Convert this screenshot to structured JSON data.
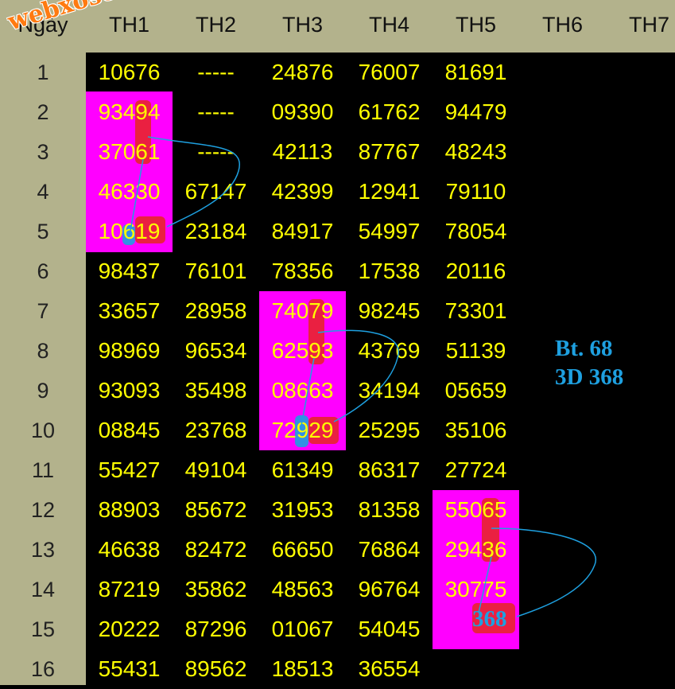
{
  "logo_text": "webxoso.net",
  "header": {
    "day": "Ngày",
    "cols": [
      "TH1",
      "TH2",
      "TH3",
      "TH4",
      "TH5",
      "TH6",
      "TH7"
    ]
  },
  "days": [
    "1",
    "2",
    "3",
    "4",
    "5",
    "6",
    "7",
    "8",
    "9",
    "10",
    "11",
    "12",
    "13",
    "14",
    "15",
    "16"
  ],
  "rows": [
    [
      "10676",
      "-----",
      "24876",
      "76007",
      "81691",
      "",
      ""
    ],
    [
      "93494",
      "-----",
      "09390",
      "61762",
      "94479",
      "",
      ""
    ],
    [
      "37061",
      "-----",
      "42113",
      "87767",
      "48243",
      "",
      ""
    ],
    [
      "46330",
      "67147",
      "42399",
      "12941",
      "79110",
      "",
      ""
    ],
    [
      "10619",
      "23184",
      "84917",
      "54997",
      "78054",
      "",
      ""
    ],
    [
      "98437",
      "76101",
      "78356",
      "17538",
      "20116",
      "",
      ""
    ],
    [
      "33657",
      "28958",
      "74079",
      "98245",
      "73301",
      "",
      ""
    ],
    [
      "98969",
      "96534",
      "62593",
      "43769",
      "51139",
      "",
      ""
    ],
    [
      "93093",
      "35498",
      "08663",
      "34194",
      "05659",
      "",
      ""
    ],
    [
      "08845",
      "23768",
      "72929",
      "25295",
      "35106",
      "",
      ""
    ],
    [
      "55427",
      "49104",
      "61349",
      "86317",
      "27724",
      "",
      ""
    ],
    [
      "88903",
      "85672",
      "31953",
      "81358",
      "55065",
      "",
      ""
    ],
    [
      "46638",
      "82472",
      "66650",
      "76864",
      "29436",
      "",
      ""
    ],
    [
      "87219",
      "35862",
      "48563",
      "96764",
      "30775",
      "",
      ""
    ],
    [
      "20222",
      "87296",
      "01067",
      "54045",
      "",
      "",
      ""
    ],
    [
      "55431",
      "89562",
      "18513",
      "36554",
      "",
      "",
      ""
    ]
  ],
  "annotations": {
    "bt": "Bt. 68",
    "d3": "3D 368",
    "n368": "368"
  },
  "colors": {
    "header_bg": "#b3b28c",
    "cell_bg": "#000000",
    "number": "#ffff00",
    "highlight": "#ff00ff",
    "mark_red": "#e8242c",
    "mark_blue": "#1ea0e0"
  }
}
